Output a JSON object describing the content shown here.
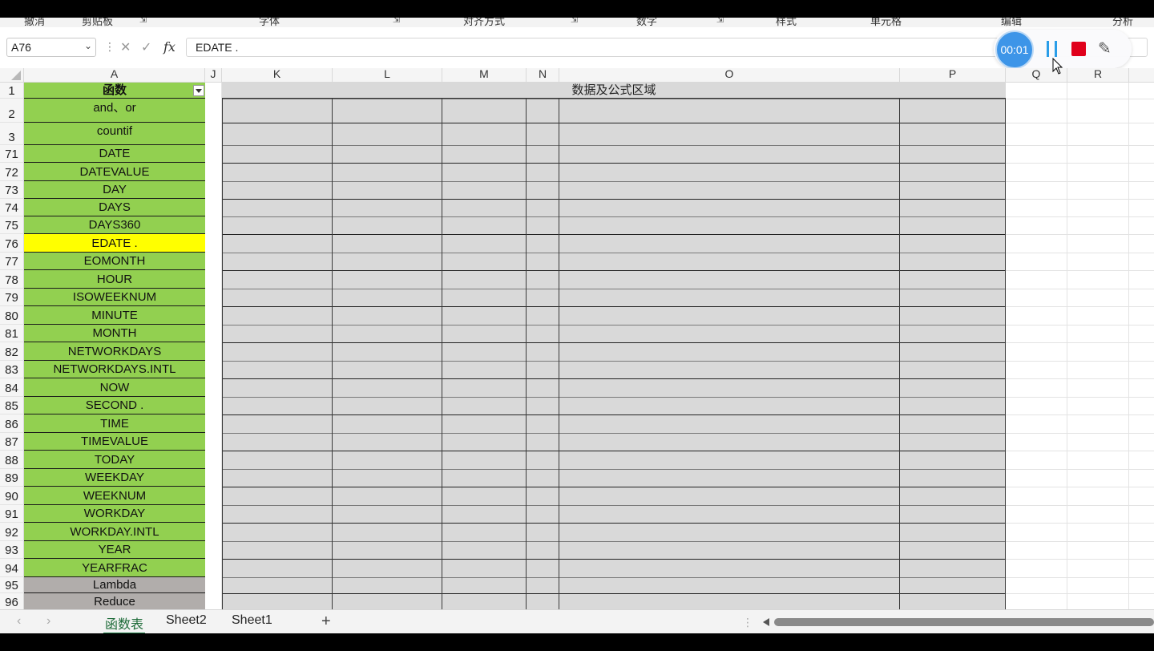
{
  "ribbon": {
    "groups": [
      "撤消",
      "剪贴板",
      "字体",
      "对齐方式",
      "数字",
      "样式",
      "单元格",
      "编辑",
      "分析"
    ]
  },
  "formula_bar": {
    "name_box": "A76",
    "formula": "EDATE .",
    "fx_label": "fx"
  },
  "recorder": {
    "time": "00:01"
  },
  "columns": [
    "A",
    "J",
    "K",
    "L",
    "M",
    "N",
    "O",
    "P",
    "Q",
    "R"
  ],
  "data_area_title": "数据及公式区域",
  "rows": [
    {
      "num": "1",
      "label": "函数",
      "style": "header"
    },
    {
      "num": "2",
      "label": "and、or",
      "style": "green"
    },
    {
      "num": "3",
      "label": "countif",
      "style": "green"
    },
    {
      "num": "71",
      "label": "DATE",
      "style": "green"
    },
    {
      "num": "72",
      "label": "DATEVALUE",
      "style": "green"
    },
    {
      "num": "73",
      "label": "DAY",
      "style": "green"
    },
    {
      "num": "74",
      "label": "DAYS",
      "style": "green"
    },
    {
      "num": "75",
      "label": "DAYS360",
      "style": "green"
    },
    {
      "num": "76",
      "label": "EDATE .",
      "style": "yellow"
    },
    {
      "num": "77",
      "label": "EOMONTH",
      "style": "green"
    },
    {
      "num": "78",
      "label": "HOUR",
      "style": "green"
    },
    {
      "num": "79",
      "label": "ISOWEEKNUM",
      "style": "green"
    },
    {
      "num": "80",
      "label": "MINUTE",
      "style": "green"
    },
    {
      "num": "81",
      "label": "MONTH",
      "style": "green"
    },
    {
      "num": "82",
      "label": "NETWORKDAYS",
      "style": "green"
    },
    {
      "num": "83",
      "label": "NETWORKDAYS.INTL",
      "style": "green"
    },
    {
      "num": "84",
      "label": "NOW",
      "style": "green"
    },
    {
      "num": "85",
      "label": "SECOND .",
      "style": "green"
    },
    {
      "num": "86",
      "label": "TIME",
      "style": "green"
    },
    {
      "num": "87",
      "label": "TIMEVALUE",
      "style": "green"
    },
    {
      "num": "88",
      "label": "TODAY",
      "style": "green"
    },
    {
      "num": "89",
      "label": "WEEKDAY",
      "style": "green"
    },
    {
      "num": "90",
      "label": "WEEKNUM",
      "style": "green"
    },
    {
      "num": "91",
      "label": "WORKDAY",
      "style": "green"
    },
    {
      "num": "92",
      "label": "WORKDAY.INTL",
      "style": "green"
    },
    {
      "num": "93",
      "label": "YEAR",
      "style": "green"
    },
    {
      "num": "94",
      "label": "YEARFRAC",
      "style": "green"
    },
    {
      "num": "95",
      "label": "Lambda",
      "style": "gray"
    },
    {
      "num": "96",
      "label": "Reduce",
      "style": "gray"
    }
  ],
  "sheet_tabs": [
    {
      "label": "函数表",
      "active": true
    },
    {
      "label": "Sheet2",
      "active": false
    },
    {
      "label": "Sheet1",
      "active": false
    }
  ],
  "add_sheet_label": "+",
  "colors": {
    "green_fill": "#92d050",
    "selected_fill": "#ffff00",
    "gray_fill": "#b1adab",
    "data_area_fill": "#d9d9d9",
    "recorder_blue": "#3d95e8",
    "stop_red": "#e0001b"
  }
}
